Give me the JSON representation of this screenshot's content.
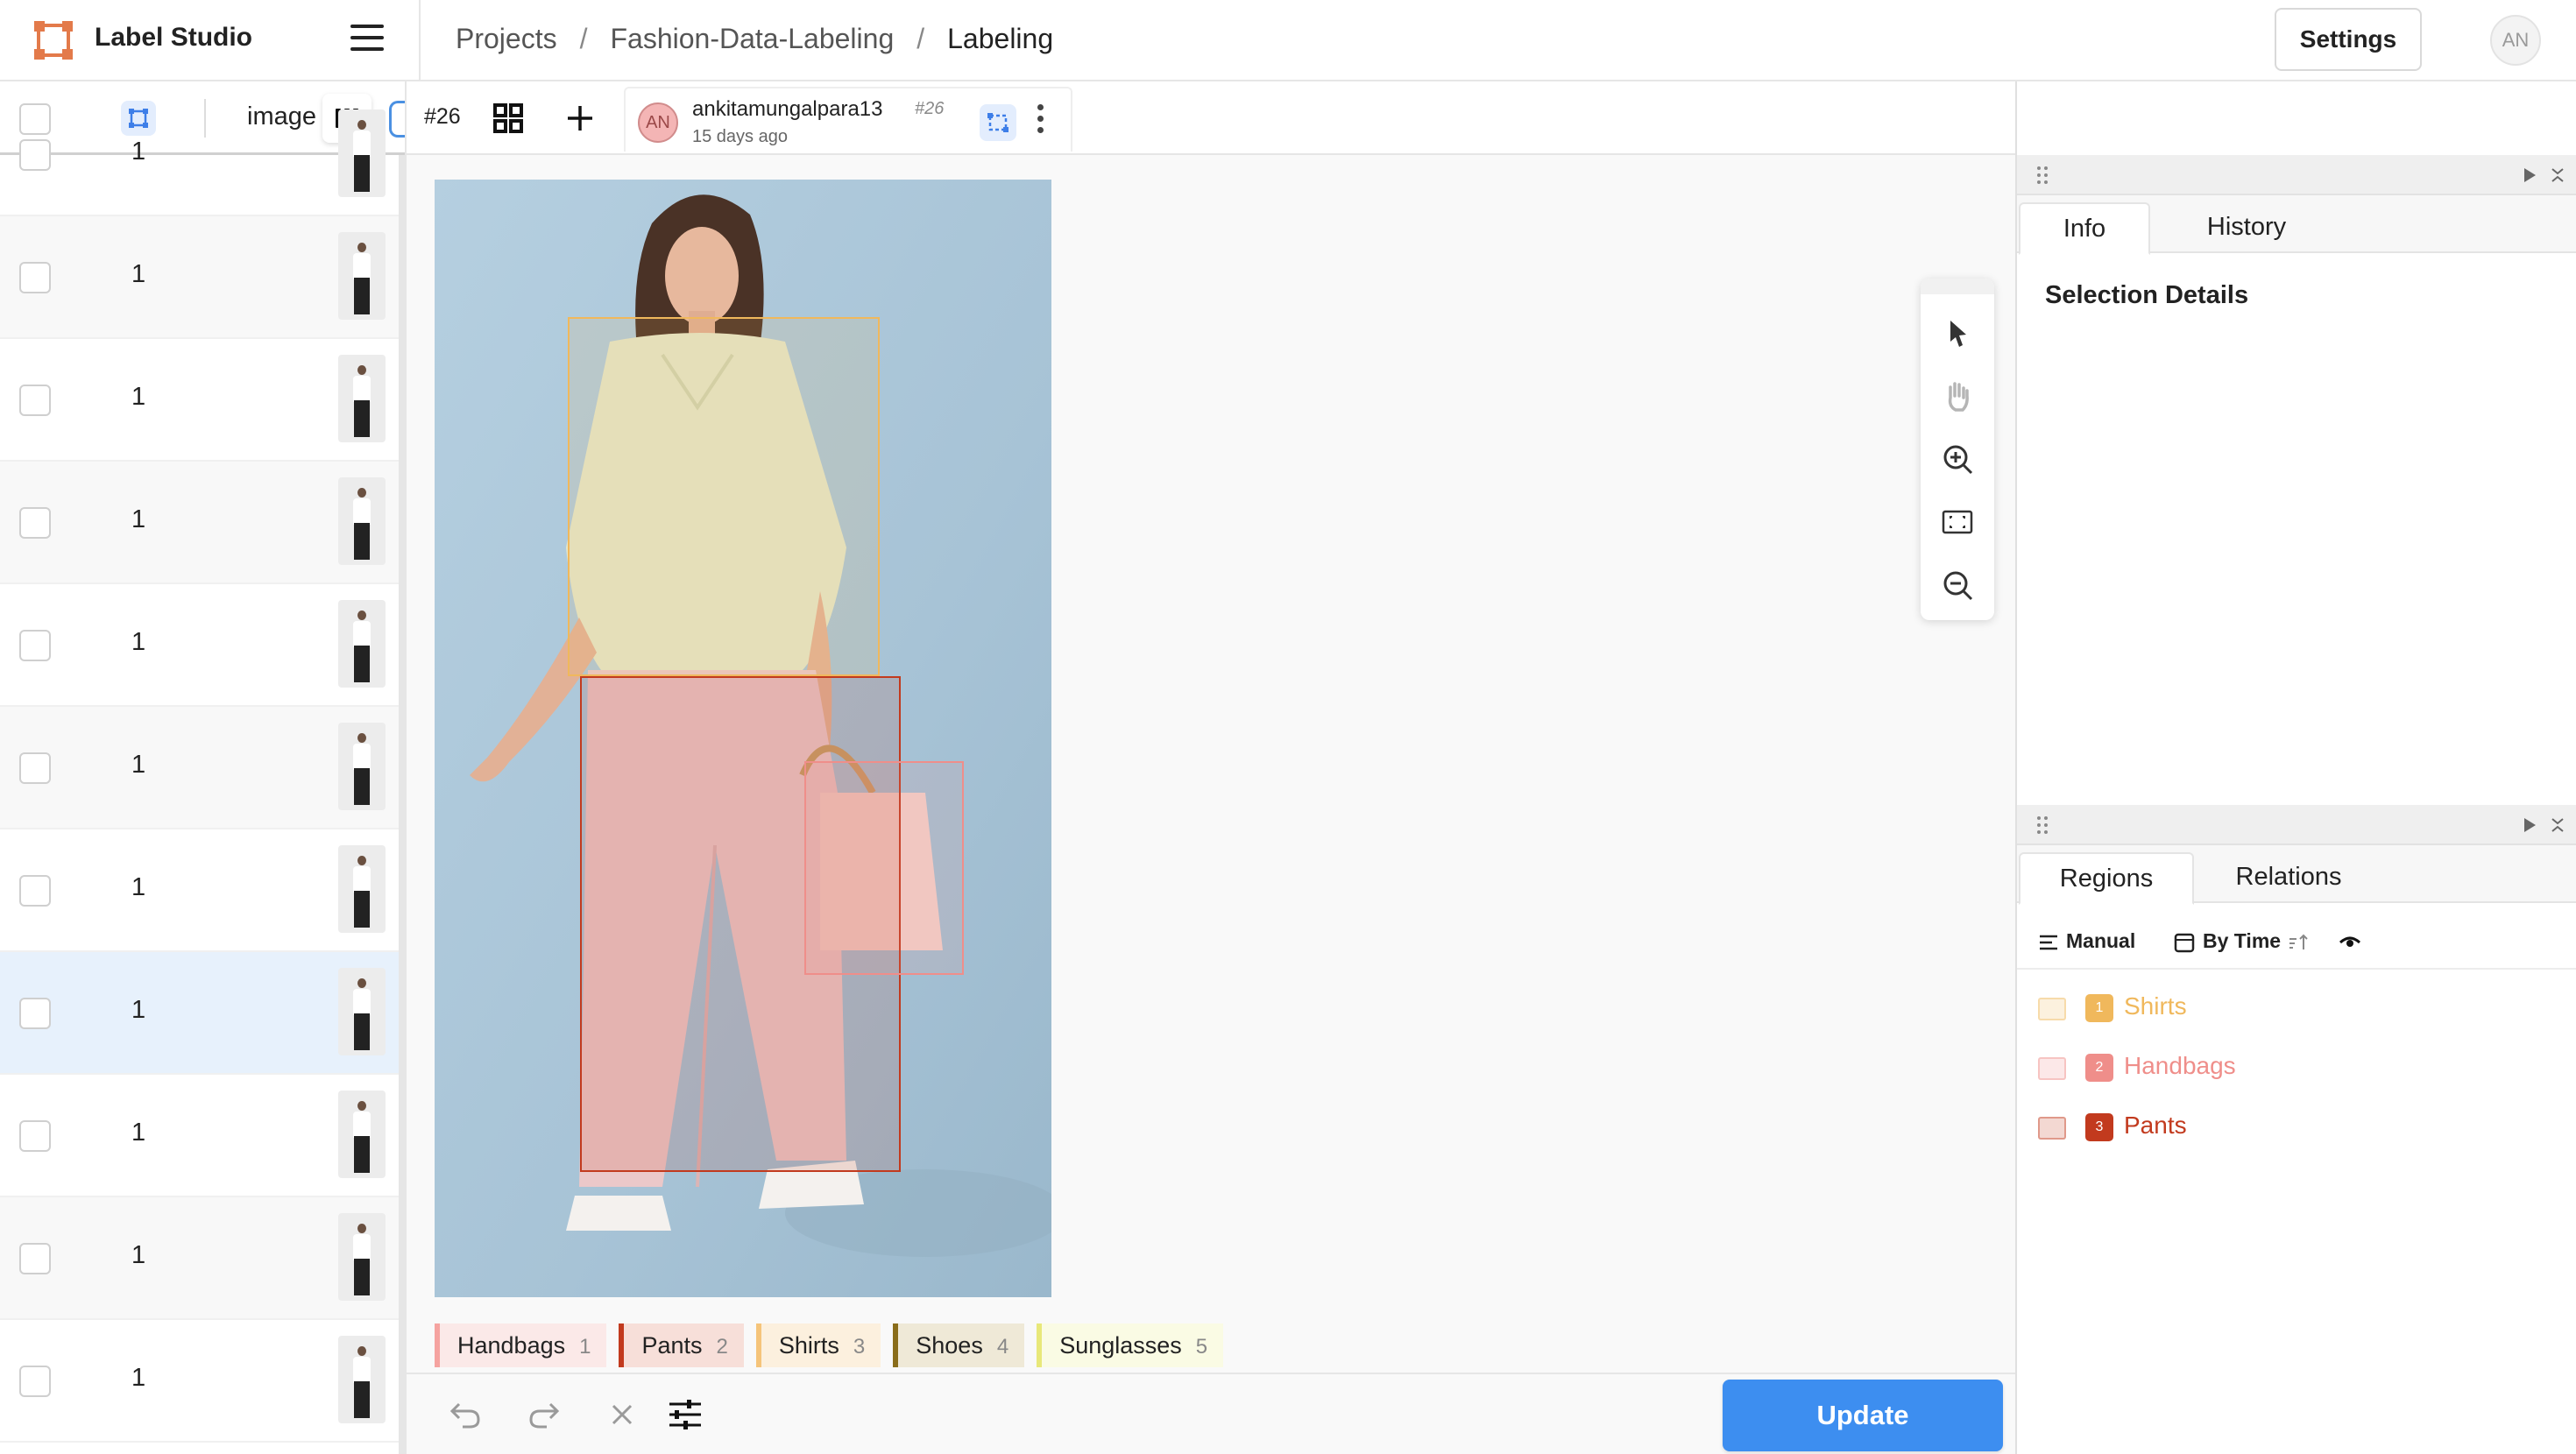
{
  "app": {
    "name": "Label Studio",
    "breadcrumb": [
      "Projects",
      "Fashion-Data-Labeling",
      "Labeling"
    ],
    "settings_label": "Settings",
    "user_initials": "AN"
  },
  "tasklist": {
    "column_label": "image",
    "rows": [
      {
        "count": "1",
        "selected": false
      },
      {
        "count": "1",
        "selected": false
      },
      {
        "count": "1",
        "selected": false
      },
      {
        "count": "1",
        "selected": false
      },
      {
        "count": "1",
        "selected": false
      },
      {
        "count": "1",
        "selected": false
      },
      {
        "count": "1",
        "selected": false
      },
      {
        "count": "1",
        "selected": true
      },
      {
        "count": "1",
        "selected": false
      },
      {
        "count": "1",
        "selected": false
      },
      {
        "count": "1",
        "selected": false
      }
    ]
  },
  "annotation": {
    "task_id": "#26",
    "author_initials": "AN",
    "author": "ankitamungalpara13",
    "annotation_id": "#26",
    "time_ago": "15 days ago"
  },
  "regions": [
    {
      "index": "1",
      "label": "Shirts",
      "color": "#f0b85c"
    },
    {
      "index": "2",
      "label": "Handbags",
      "color": "#ef8e8a"
    },
    {
      "index": "3",
      "label": "Pants",
      "color": "#c23a1e"
    }
  ],
  "label_chips": [
    {
      "label": "Handbags",
      "hotkey": "1",
      "color": "#f5a3a0",
      "bg": "#fbe9e8"
    },
    {
      "label": "Pants",
      "hotkey": "2",
      "color": "#c23a1e",
      "bg": "#f7dfd9"
    },
    {
      "label": "Shirts",
      "hotkey": "3",
      "color": "#f5c47a",
      "bg": "#fcf0de"
    },
    {
      "label": "Shoes",
      "hotkey": "4",
      "color": "#8a6d1a",
      "bg": "#efe9d7"
    },
    {
      "label": "Sunglasses",
      "hotkey": "5",
      "color": "#e8e87a",
      "bg": "#fafbe4"
    }
  ],
  "controls": {
    "update_label": "Update"
  },
  "sidebar": {
    "top_tabs": [
      "Info",
      "History"
    ],
    "active_top_tab": "Info",
    "selection_details": "Selection Details",
    "bottom_tabs": [
      "Regions",
      "Relations"
    ],
    "active_bottom_tab": "Regions",
    "sort_manual": "Manual",
    "sort_by_time": "By Time"
  },
  "colors": {
    "accent": "#3d8ef0",
    "selected_row": "#e7f1fc"
  }
}
